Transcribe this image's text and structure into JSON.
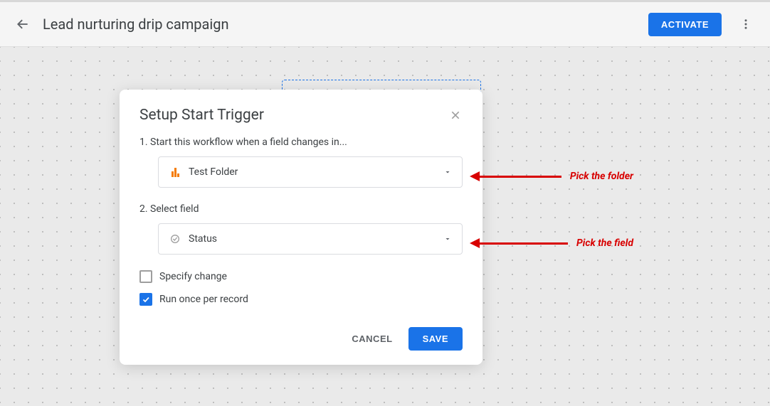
{
  "header": {
    "title": "Lead nurturing drip campaign",
    "activate_label": "ACTIVATE"
  },
  "modal": {
    "title": "Setup Start Trigger",
    "step1_label": "1. Start this workflow when a field changes in...",
    "step2_label": "2. Select field",
    "folder_value": "Test Folder",
    "field_value": "Status",
    "specify_change_label": "Specify change",
    "run_once_label": "Run once per record",
    "cancel_label": "CANCEL",
    "save_label": "SAVE"
  },
  "annotations": {
    "pick_folder": "Pick the folder",
    "pick_field": "Pick the field"
  }
}
